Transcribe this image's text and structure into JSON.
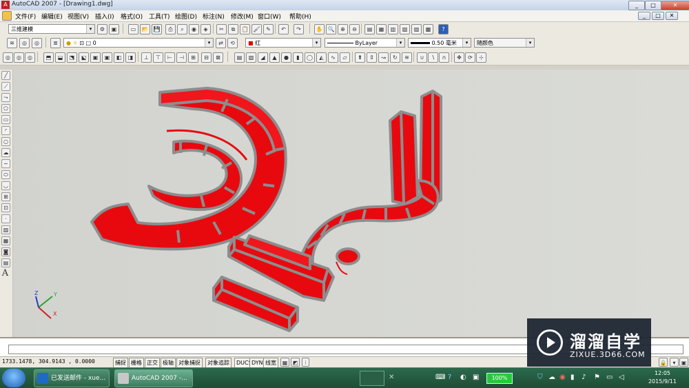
{
  "window": {
    "title": "AutoCAD 2007 - [Drawing1.dwg]",
    "controls": [
      "_",
      "□",
      "✕"
    ],
    "doc_controls": [
      "_",
      "□",
      "✕"
    ]
  },
  "menu": [
    "文件(F)",
    "编辑(E)",
    "视图(V)",
    "插入(I)",
    "格式(O)",
    "工具(T)",
    "绘图(D)",
    "标注(N)",
    "修改(M)",
    "窗口(W)",
    "帮助(H)"
  ],
  "toolbars": {
    "workspace": "三维建模",
    "layer": "0",
    "color": "红",
    "linetype": "ByLayer",
    "lineweight": "0.50 毫米",
    "plotstyle": "随颜色",
    "text_tool_label": "A"
  },
  "ucs": {
    "x": "X",
    "y": "Y",
    "z": "Z"
  },
  "command_line": "",
  "status": {
    "coords": "1733.1478,  304.9143 ,  0.0000",
    "buttons": [
      "捕捉",
      "栅格",
      "正交",
      "极轴",
      "对象捕捉",
      "对象追踪",
      "DUCS",
      "DYN",
      "线宽"
    ]
  },
  "taskbar": {
    "tasks": [
      "已发送邮件 - xue...",
      "AutoCAD 2007 -..."
    ],
    "battery": "100%",
    "time": "12:05",
    "date": "2015/9/11"
  },
  "watermark": {
    "brand": "溜溜自学",
    "site": "ZIXUE.3D66.COM"
  },
  "colors": {
    "solid_red": "#e8090f",
    "solid_edge": "#8d8d8d",
    "canvas_bg": "#d5d6d2",
    "taskbar": "#245a3f"
  }
}
